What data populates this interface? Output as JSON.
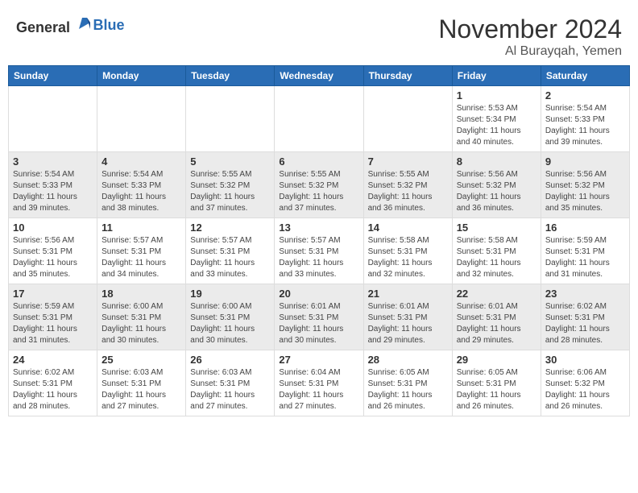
{
  "header": {
    "logo_general": "General",
    "logo_blue": "Blue",
    "month_year": "November 2024",
    "location": "Al Burayqah, Yemen"
  },
  "weekdays": [
    "Sunday",
    "Monday",
    "Tuesday",
    "Wednesday",
    "Thursday",
    "Friday",
    "Saturday"
  ],
  "weeks": [
    [
      {
        "day": "",
        "info": ""
      },
      {
        "day": "",
        "info": ""
      },
      {
        "day": "",
        "info": ""
      },
      {
        "day": "",
        "info": ""
      },
      {
        "day": "",
        "info": ""
      },
      {
        "day": "1",
        "info": "Sunrise: 5:53 AM\nSunset: 5:34 PM\nDaylight: 11 hours and 40 minutes."
      },
      {
        "day": "2",
        "info": "Sunrise: 5:54 AM\nSunset: 5:33 PM\nDaylight: 11 hours and 39 minutes."
      }
    ],
    [
      {
        "day": "3",
        "info": "Sunrise: 5:54 AM\nSunset: 5:33 PM\nDaylight: 11 hours and 39 minutes."
      },
      {
        "day": "4",
        "info": "Sunrise: 5:54 AM\nSunset: 5:33 PM\nDaylight: 11 hours and 38 minutes."
      },
      {
        "day": "5",
        "info": "Sunrise: 5:55 AM\nSunset: 5:32 PM\nDaylight: 11 hours and 37 minutes."
      },
      {
        "day": "6",
        "info": "Sunrise: 5:55 AM\nSunset: 5:32 PM\nDaylight: 11 hours and 37 minutes."
      },
      {
        "day": "7",
        "info": "Sunrise: 5:55 AM\nSunset: 5:32 PM\nDaylight: 11 hours and 36 minutes."
      },
      {
        "day": "8",
        "info": "Sunrise: 5:56 AM\nSunset: 5:32 PM\nDaylight: 11 hours and 36 minutes."
      },
      {
        "day": "9",
        "info": "Sunrise: 5:56 AM\nSunset: 5:32 PM\nDaylight: 11 hours and 35 minutes."
      }
    ],
    [
      {
        "day": "10",
        "info": "Sunrise: 5:56 AM\nSunset: 5:31 PM\nDaylight: 11 hours and 35 minutes."
      },
      {
        "day": "11",
        "info": "Sunrise: 5:57 AM\nSunset: 5:31 PM\nDaylight: 11 hours and 34 minutes."
      },
      {
        "day": "12",
        "info": "Sunrise: 5:57 AM\nSunset: 5:31 PM\nDaylight: 11 hours and 33 minutes."
      },
      {
        "day": "13",
        "info": "Sunrise: 5:57 AM\nSunset: 5:31 PM\nDaylight: 11 hours and 33 minutes."
      },
      {
        "day": "14",
        "info": "Sunrise: 5:58 AM\nSunset: 5:31 PM\nDaylight: 11 hours and 32 minutes."
      },
      {
        "day": "15",
        "info": "Sunrise: 5:58 AM\nSunset: 5:31 PM\nDaylight: 11 hours and 32 minutes."
      },
      {
        "day": "16",
        "info": "Sunrise: 5:59 AM\nSunset: 5:31 PM\nDaylight: 11 hours and 31 minutes."
      }
    ],
    [
      {
        "day": "17",
        "info": "Sunrise: 5:59 AM\nSunset: 5:31 PM\nDaylight: 11 hours and 31 minutes."
      },
      {
        "day": "18",
        "info": "Sunrise: 6:00 AM\nSunset: 5:31 PM\nDaylight: 11 hours and 30 minutes."
      },
      {
        "day": "19",
        "info": "Sunrise: 6:00 AM\nSunset: 5:31 PM\nDaylight: 11 hours and 30 minutes."
      },
      {
        "day": "20",
        "info": "Sunrise: 6:01 AM\nSunset: 5:31 PM\nDaylight: 11 hours and 30 minutes."
      },
      {
        "day": "21",
        "info": "Sunrise: 6:01 AM\nSunset: 5:31 PM\nDaylight: 11 hours and 29 minutes."
      },
      {
        "day": "22",
        "info": "Sunrise: 6:01 AM\nSunset: 5:31 PM\nDaylight: 11 hours and 29 minutes."
      },
      {
        "day": "23",
        "info": "Sunrise: 6:02 AM\nSunset: 5:31 PM\nDaylight: 11 hours and 28 minutes."
      }
    ],
    [
      {
        "day": "24",
        "info": "Sunrise: 6:02 AM\nSunset: 5:31 PM\nDaylight: 11 hours and 28 minutes."
      },
      {
        "day": "25",
        "info": "Sunrise: 6:03 AM\nSunset: 5:31 PM\nDaylight: 11 hours and 27 minutes."
      },
      {
        "day": "26",
        "info": "Sunrise: 6:03 AM\nSunset: 5:31 PM\nDaylight: 11 hours and 27 minutes."
      },
      {
        "day": "27",
        "info": "Sunrise: 6:04 AM\nSunset: 5:31 PM\nDaylight: 11 hours and 27 minutes."
      },
      {
        "day": "28",
        "info": "Sunrise: 6:05 AM\nSunset: 5:31 PM\nDaylight: 11 hours and 26 minutes."
      },
      {
        "day": "29",
        "info": "Sunrise: 6:05 AM\nSunset: 5:31 PM\nDaylight: 11 hours and 26 minutes."
      },
      {
        "day": "30",
        "info": "Sunrise: 6:06 AM\nSunset: 5:32 PM\nDaylight: 11 hours and 26 minutes."
      }
    ]
  ]
}
